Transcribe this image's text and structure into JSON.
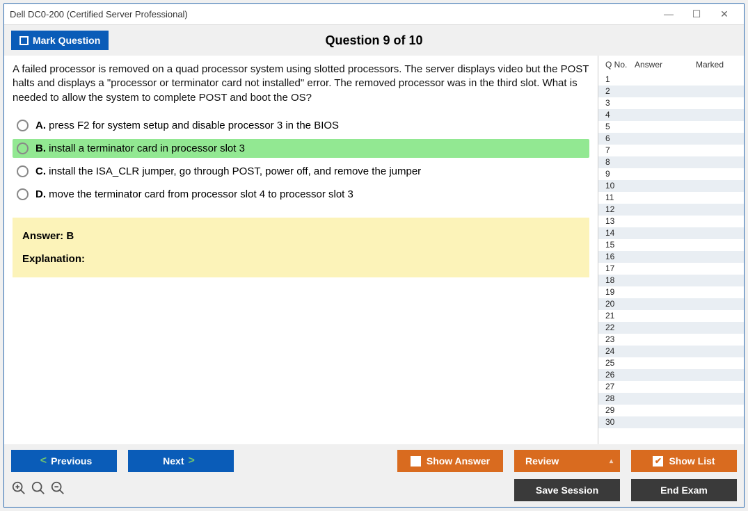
{
  "window": {
    "title": "Dell DC0-200 (Certified Server Professional)"
  },
  "header": {
    "mark_label": "Mark Question",
    "counter": "Question 9 of 10"
  },
  "question": {
    "text": "A failed processor is removed on a quad processor system using slotted processors. The server displays video but the POST halts and displays a \"processor or terminator card not installed\" error. The removed processor was in the third slot. What is needed to allow the system to complete POST and boot the OS?",
    "options": [
      {
        "letter": "A.",
        "text": "press F2 for system setup and disable processor 3 in the BIOS",
        "correct": false
      },
      {
        "letter": "B.",
        "text": "install a terminator card in processor slot 3",
        "correct": true
      },
      {
        "letter": "C.",
        "text": "install the ISA_CLR jumper, go through POST, power off, and remove the jumper",
        "correct": false
      },
      {
        "letter": "D.",
        "text": "move the terminator card from processor slot 4 to processor slot 3",
        "correct": false
      }
    ],
    "answer_label": "Answer: B",
    "explanation_label": "Explanation:"
  },
  "side": {
    "col_qno": "Q No.",
    "col_answer": "Answer",
    "col_marked": "Marked",
    "rows": [
      1,
      2,
      3,
      4,
      5,
      6,
      7,
      8,
      9,
      10,
      11,
      12,
      13,
      14,
      15,
      16,
      17,
      18,
      19,
      20,
      21,
      22,
      23,
      24,
      25,
      26,
      27,
      28,
      29,
      30
    ]
  },
  "footer": {
    "previous": "Previous",
    "next": "Next",
    "show_answer": "Show Answer",
    "review": "Review",
    "show_list": "Show List",
    "save_session": "Save Session",
    "end_exam": "End Exam"
  }
}
